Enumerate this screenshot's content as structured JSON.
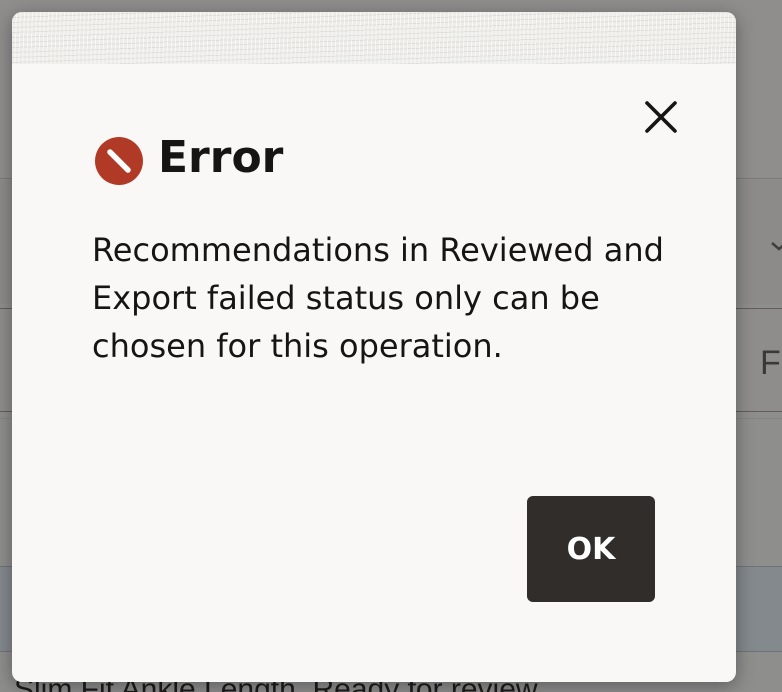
{
  "background": {
    "field_partial_text": "F",
    "row_partial_text": "Slim Fit Ankle Length, Ready for review"
  },
  "dialog": {
    "icon": "error-circle-icon",
    "title": "Error",
    "message": "Recommendations in Reviewed and Export failed status only can be chosen for this operation.",
    "ok_label": "OK",
    "close_icon": "close-icon"
  },
  "colors": {
    "error_icon": "#b13a27",
    "ok_button_bg": "#312d2a",
    "dialog_bg": "#f9f8f6",
    "text": "#161513"
  }
}
